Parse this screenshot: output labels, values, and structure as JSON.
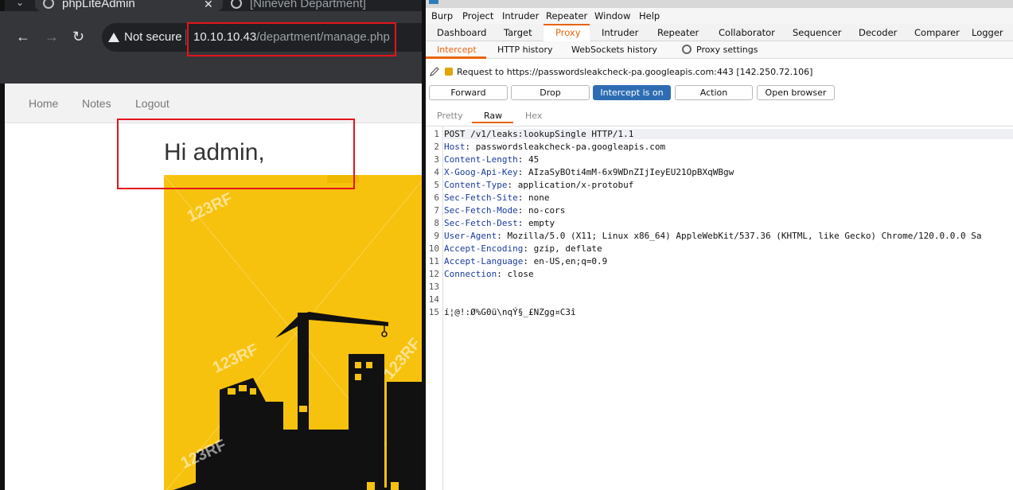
{
  "browser": {
    "tabs": [
      {
        "title": "phpLiteAdmin",
        "close": "✕"
      },
      {
        "title": "[Nineveh Department]",
        "close": "✕"
      }
    ],
    "nav": {
      "back": "←",
      "forward": "→",
      "reload": "↻"
    },
    "security_label": "Not secure",
    "url_host": "10.10.10.43",
    "url_path": "/department/manage.php",
    "site": {
      "nav": [
        "Home",
        "Notes",
        "Logout"
      ],
      "greeting": "Hi admin,",
      "watermark": "123RF"
    }
  },
  "burp": {
    "menu": [
      "Burp",
      "Project",
      "Intruder",
      "Repeater",
      "Window",
      "Help"
    ],
    "main_tabs": [
      "Dashboard",
      "Target",
      "Proxy",
      "Intruder",
      "Repeater",
      "Collaborator",
      "Sequencer",
      "Decoder",
      "Comparer",
      "Logger"
    ],
    "active_main_tab": "Proxy",
    "proxy_tabs": [
      "Intercept",
      "HTTP history",
      "WebSockets history"
    ],
    "proxy_settings": "Proxy settings",
    "request_info": "Request to https://passwordsleakcheck-pa.googleapis.com:443 [142.250.72.106]",
    "buttons": [
      "Forward",
      "Drop",
      "Intercept is on",
      "Action",
      "Open browser"
    ],
    "view_tabs": [
      "Pretty",
      "Raw",
      "Hex"
    ],
    "active_view_tab": "Raw",
    "accent_color": "#e8640c",
    "request_lines": [
      {
        "n": "1",
        "key": "",
        "value": "POST /v1/leaks:lookupSingle HTTP/1.1"
      },
      {
        "n": "2",
        "key": "Host",
        "value": ": passwordsleakcheck-pa.googleapis.com"
      },
      {
        "n": "3",
        "key": "Content-Length",
        "value": ": 45"
      },
      {
        "n": "4",
        "key": "X-Goog-Api-Key",
        "value": ": AIzaSyBOti4mM-6x9WDnZIjIeyEU21OpBXqWBgw"
      },
      {
        "n": "5",
        "key": "Content-Type",
        "value": ": application/x-protobuf"
      },
      {
        "n": "6",
        "key": "Sec-Fetch-Site",
        "value": ": none"
      },
      {
        "n": "7",
        "key": "Sec-Fetch-Mode",
        "value": ": no-cors"
      },
      {
        "n": "8",
        "key": "Sec-Fetch-Dest",
        "value": ": empty"
      },
      {
        "n": "9",
        "key": "User-Agent",
        "value": ": Mozilla/5.0 (X11; Linux x86_64) AppleWebKit/537.36 (KHTML, like Gecko) Chrome/120.0.0.0 Sa"
      },
      {
        "n": "10",
        "key": "Accept-Encoding",
        "value": ": gzip, deflate"
      },
      {
        "n": "11",
        "key": "Accept-Language",
        "value": ": en-US,en;q=0.9"
      },
      {
        "n": "12",
        "key": "Connection",
        "value": ": close"
      },
      {
        "n": "13",
        "key": "",
        "value": ""
      },
      {
        "n": "14",
        "key": "",
        "value": ""
      },
      {
        "n": "15",
        "key": "",
        "value": "í¦@!:Ø%G0ü\\nqÝ§_£NZgg¤C3î"
      }
    ]
  }
}
